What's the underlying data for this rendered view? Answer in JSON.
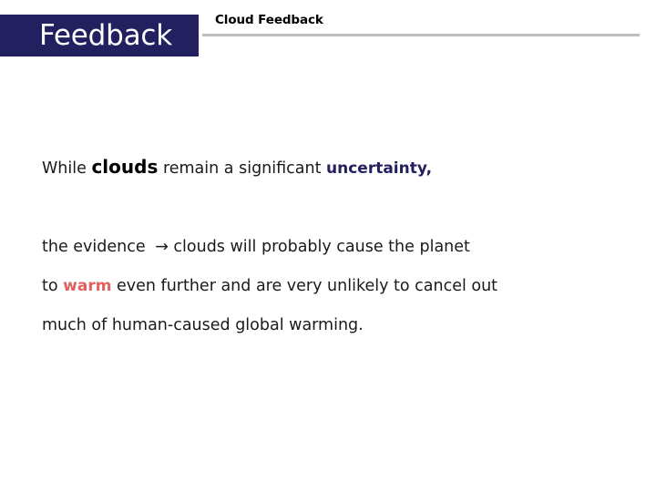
{
  "slide": {
    "banner_title": "Feedback",
    "subtitle": "Cloud Feedback",
    "colors": {
      "banner_background": "#232060",
      "banner_text": "#ffffff",
      "rule": "#bdbdbd",
      "body_text": "#1a1a1a",
      "emphasis_uncertainty": "#24205e",
      "emphasis_warm": "#e0615f",
      "emphasis_clouds": "#000000",
      "page_background": "#ffffff"
    }
  },
  "body": {
    "line1": {
      "part_a": "While ",
      "emphasis_clouds": "clouds",
      "part_b": " remain a significant ",
      "emphasis_uncertainty": "uncertainty,"
    },
    "line2": {
      "part_a": "the evidence ",
      "arrow": "→",
      "part_b": " clouds will probably cause the planet"
    },
    "line3": {
      "part_a": "to ",
      "emphasis_warm": "warm",
      "part_b": " even further and are very unlikely to cancel out"
    },
    "line4": {
      "text": "much of human-caused global warming."
    }
  }
}
